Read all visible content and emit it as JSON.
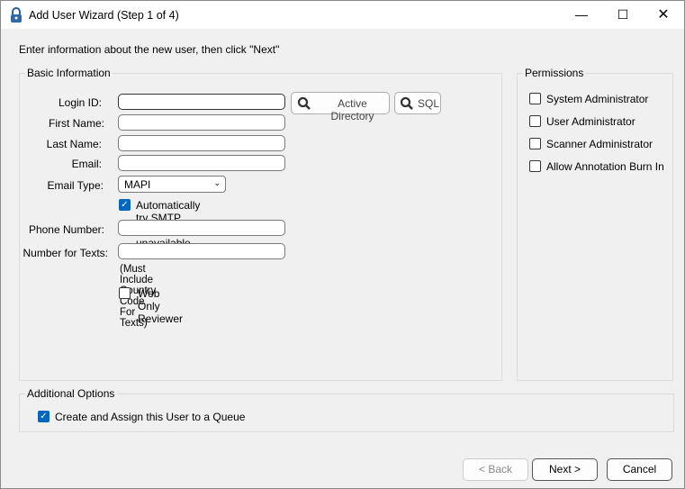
{
  "window": {
    "title": "Add User Wizard (Step 1 of 4)",
    "icon": "lock-icon"
  },
  "instruction": "Enter information about the new user, then click \"Next\"",
  "basic": {
    "legend": "Basic Information",
    "login_label": "Login ID:",
    "login_value": "",
    "first_label": "First Name:",
    "first_value": "",
    "last_label": "Last Name:",
    "last_value": "",
    "email_label": "Email:",
    "email_value": "",
    "email_type_label": "Email Type:",
    "email_type_value": "MAPI",
    "smtp_label": "Automatically try SMTP when MAPI unavailable",
    "smtp_checked": true,
    "phone_label": "Phone Number:",
    "phone_value": "",
    "texts_label": "Number for Texts:",
    "texts_value": "",
    "texts_note": "(Must Include Country Code For Texts)",
    "web_only_label": "Web Only Reviewer",
    "web_only_checked": false,
    "ad_button": "Active Directory",
    "sql_button": "SQL"
  },
  "permissions": {
    "legend": "Permissions",
    "items": [
      {
        "label": "System Administrator",
        "checked": false
      },
      {
        "label": "User Administrator",
        "checked": false
      },
      {
        "label": "Scanner Administrator",
        "checked": false
      },
      {
        "label": "Allow Annotation Burn In",
        "checked": false
      }
    ]
  },
  "additional": {
    "legend": "Additional Options",
    "queue_label": "Create and Assign this User to a Queue",
    "queue_checked": true
  },
  "footer": {
    "back": "< Back",
    "next": "Next >",
    "cancel": "Cancel"
  },
  "colors": {
    "accent": "#0067c0"
  }
}
